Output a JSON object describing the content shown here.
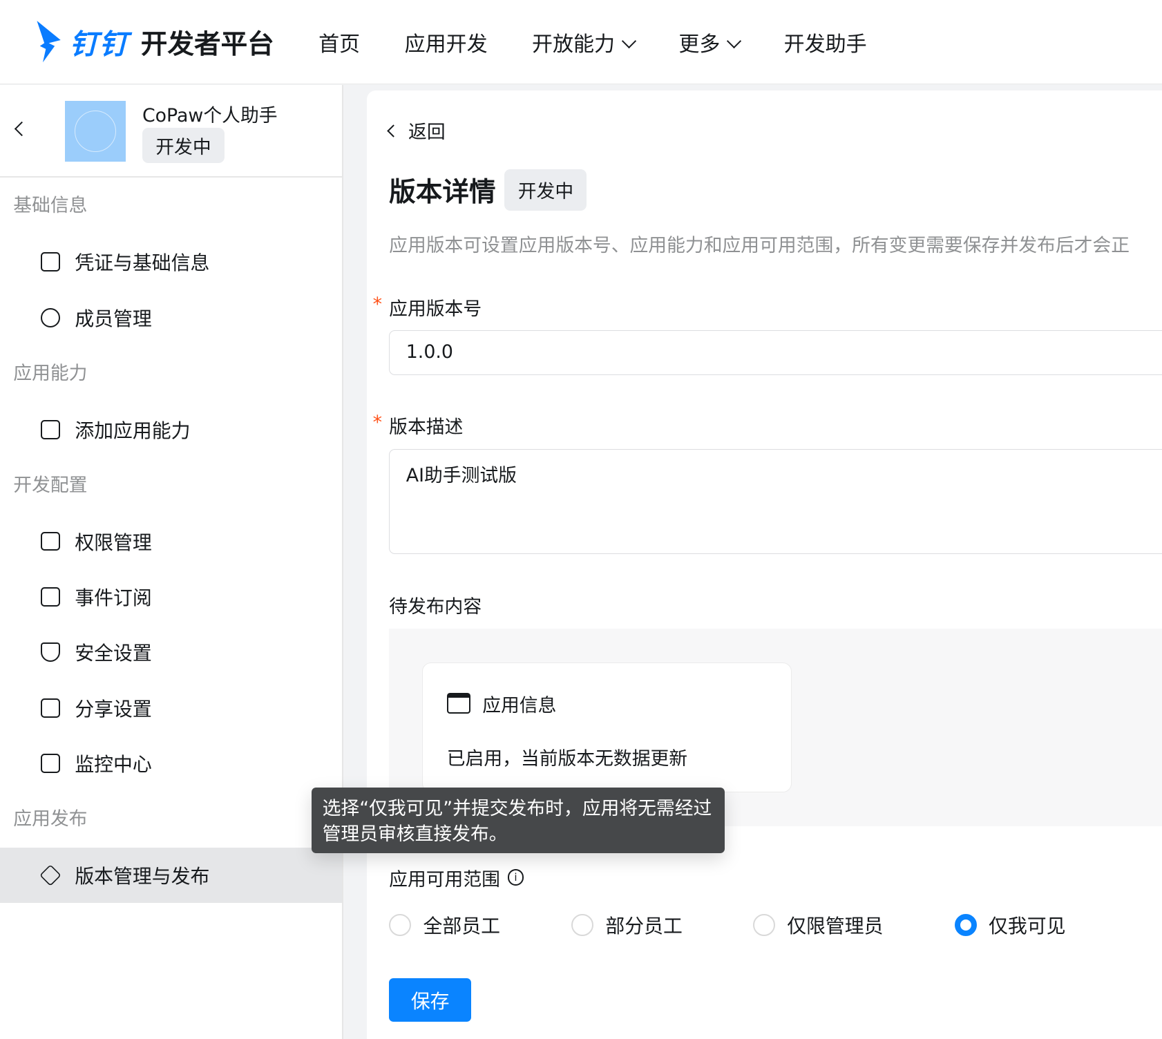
{
  "header": {
    "brand": "钉钉",
    "platform": "开发者平台",
    "nav": [
      "首页",
      "应用开发",
      "开放能力",
      "更多",
      "开发助手"
    ]
  },
  "sidebar": {
    "app_name": "CoPaw个人助手",
    "app_status": "开发中",
    "groups": [
      {
        "title": "基础信息",
        "items": [
          "凭证与基础信息",
          "成员管理"
        ]
      },
      {
        "title": "应用能力",
        "items": [
          "添加应用能力"
        ]
      },
      {
        "title": "开发配置",
        "items": [
          "权限管理",
          "事件订阅",
          "安全设置",
          "分享设置",
          "监控中心"
        ]
      },
      {
        "title": "应用发布",
        "items": [
          "版本管理与发布"
        ]
      }
    ]
  },
  "main": {
    "back": "返回",
    "title": "版本详情",
    "status": "开发中",
    "desc": "应用版本可设置应用版本号、应用能力和应用可用范围，所有变更需要保存并发布后才会正",
    "version_label": "应用版本号",
    "version_value": "1.0.0",
    "vdesc_label": "版本描述",
    "vdesc_value": "AI助手测试版",
    "pending_label": "待发布内容",
    "card_title": "应用信息",
    "card_text": "已启用，当前版本无数据更新",
    "scope_label": "应用可用范围",
    "scope_options": [
      "全部员工",
      "部分员工",
      "仅限管理员",
      "仅我可见"
    ],
    "scope_selected": "仅我可见",
    "save": "保存",
    "tooltip": "选择“仅我可见”并提交发布时，应用将无需经过管理员审核直接发布。"
  },
  "colors": {
    "accent": "#0a84ff"
  }
}
